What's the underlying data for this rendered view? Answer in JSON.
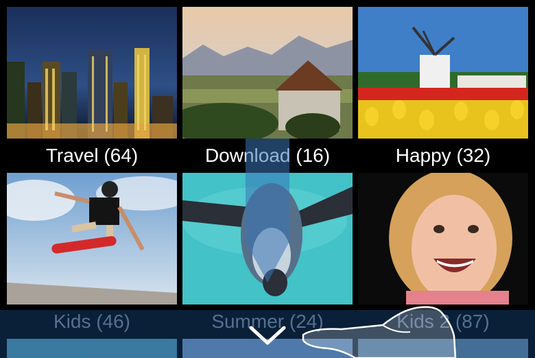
{
  "albums": [
    {
      "label": "Travel (64)",
      "icon": "city-skyline-photo"
    },
    {
      "label": "Download (16)",
      "icon": "mountain-landscape-photo"
    },
    {
      "label": "Happy (32)",
      "icon": "windmill-tulips-photo"
    },
    {
      "label": "Kids (46)",
      "icon": "skateboarder-photo"
    },
    {
      "label": "Summer (24)",
      "icon": "penguin-underwater-photo"
    },
    {
      "label": "Kids 2 (87)",
      "icon": "smiling-child-photo"
    }
  ],
  "colors": {
    "background": "#000000",
    "overlay": "#1e5aa0",
    "label_text": "#ffffff"
  },
  "gesture": {
    "indicator": "swipe-down",
    "icon": "hand-pointer-icon"
  }
}
